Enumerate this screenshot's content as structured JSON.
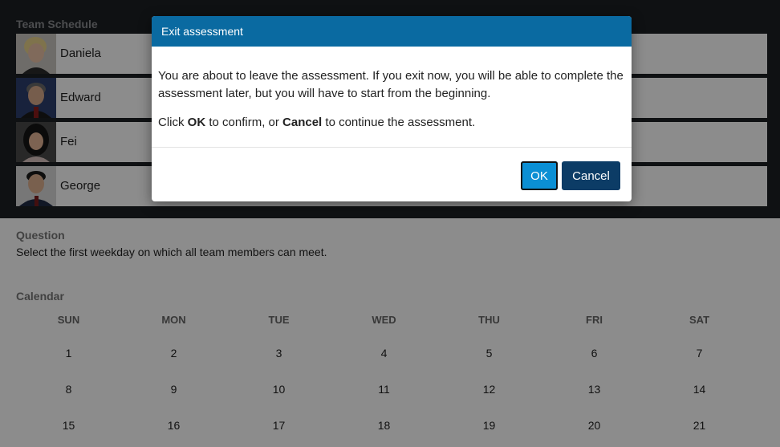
{
  "team": {
    "title": "Team Schedule",
    "members": [
      {
        "name": "Daniela",
        "avatar": "avatar-daniela"
      },
      {
        "name": "Edward",
        "avatar": "avatar-edward"
      },
      {
        "name": "Fei",
        "avatar": "avatar-fei"
      },
      {
        "name": "George",
        "avatar": "avatar-george"
      }
    ]
  },
  "question": {
    "label": "Question",
    "text": "Select the first weekday on which all team members can meet."
  },
  "calendar": {
    "label": "Calendar",
    "days": [
      "SUN",
      "MON",
      "TUE",
      "WED",
      "THU",
      "FRI",
      "SAT"
    ],
    "weeks": [
      [
        "1",
        "2",
        "3",
        "4",
        "5",
        "6",
        "7"
      ],
      [
        "8",
        "9",
        "10",
        "11",
        "12",
        "13",
        "14"
      ],
      [
        "15",
        "16",
        "17",
        "18",
        "19",
        "20",
        "21"
      ]
    ]
  },
  "dialog": {
    "title": "Exit assessment",
    "message": "You are about to leave the assessment. If you exit now, you will be able to complete the assessment later, but you will have to start from the beginning.",
    "confirm_prefix": "Click ",
    "confirm_ok": "OK",
    "confirm_middle": " to confirm, or ",
    "confirm_cancel": "Cancel",
    "confirm_suffix": " to continue the assessment.",
    "ok_label": "OK",
    "cancel_label": "Cancel"
  },
  "colors": {
    "header": "#0a6aa1",
    "ok_button": "#0b8fd4",
    "cancel_button": "#0c3c66",
    "team_background": "#1d1f23"
  }
}
